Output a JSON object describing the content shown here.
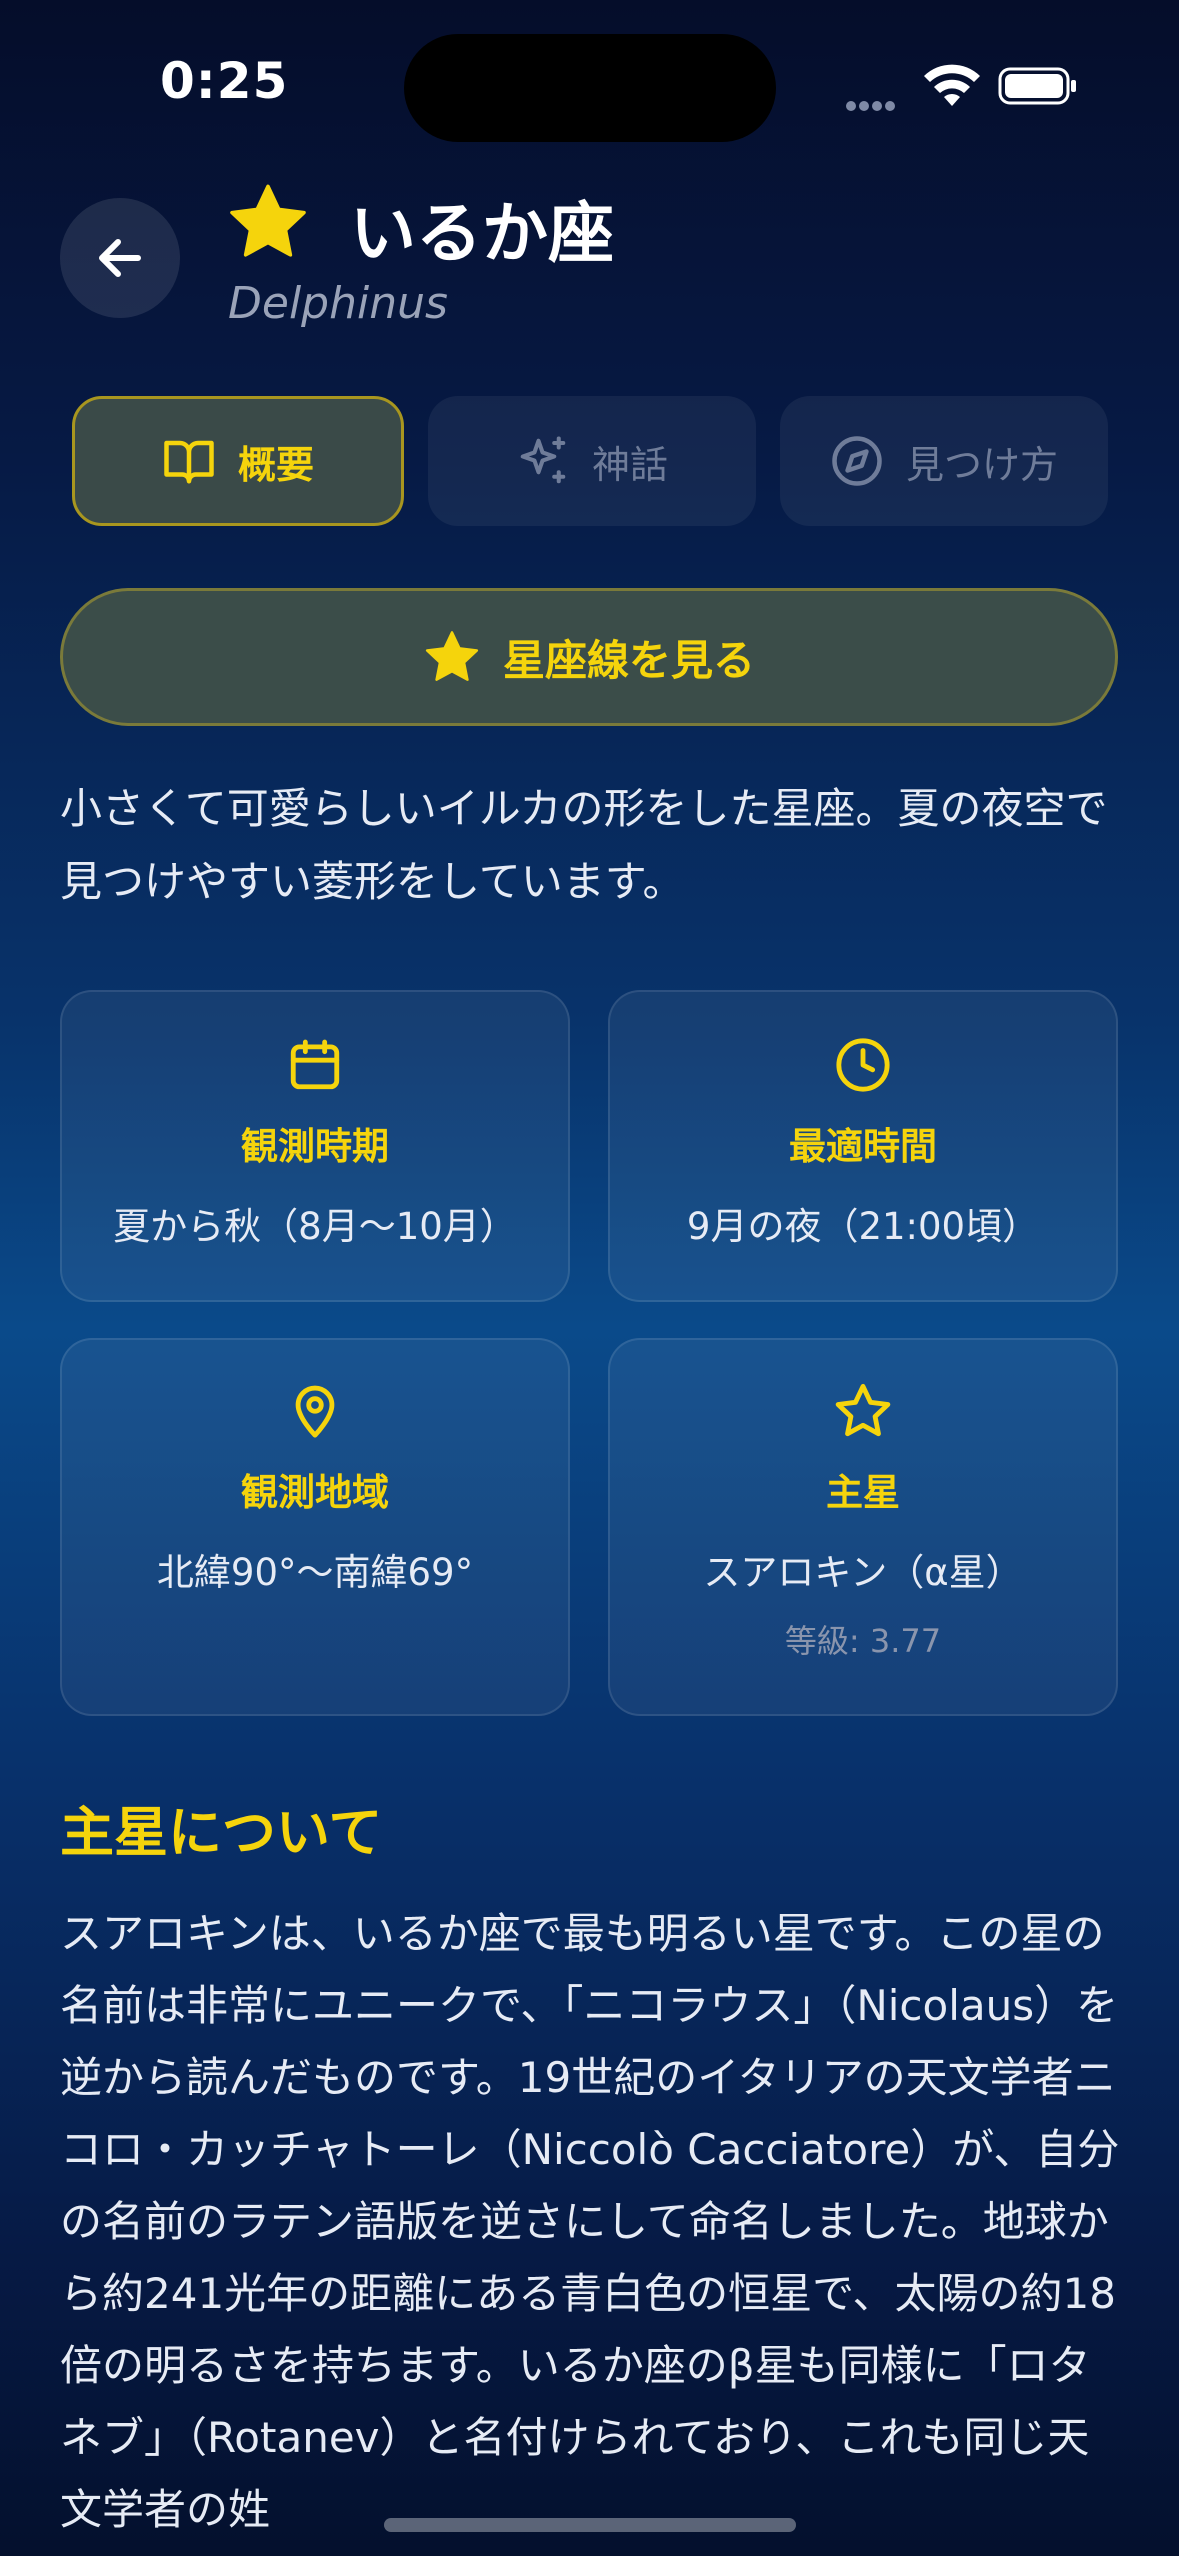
{
  "status_bar": {
    "time": "0:25"
  },
  "header": {
    "title": "いるか座",
    "subtitle": "Delphinus"
  },
  "tabs": [
    {
      "label": "概要",
      "icon": "book-icon",
      "active": true
    },
    {
      "label": "神話",
      "icon": "sparkles-icon",
      "active": false
    },
    {
      "label": "見つけ方",
      "icon": "compass-icon",
      "active": false
    }
  ],
  "constellation_button": {
    "label": "星座線を見る"
  },
  "description": "小さくて可愛らしいイルカの形をした星座。夏の夜空で見つけやすい菱形をしています。",
  "cards": {
    "season": {
      "label": "観測時期",
      "value": "夏から秋（8月〜10月）",
      "icon": "calendar-icon"
    },
    "best_time": {
      "label": "最適時間",
      "value": "9月の夜（21:00頃）",
      "icon": "clock-icon"
    },
    "region": {
      "label": "観測地域",
      "value": "北緯90°〜南緯69°",
      "icon": "map-pin-icon"
    },
    "main_star": {
      "label": "主星",
      "value": "スアロキン（α星）",
      "sub": "等級: 3.77",
      "icon": "star-outline-icon"
    }
  },
  "about": {
    "heading": "主星について",
    "body": "スアロキンは、いるか座で最も明るい星です。この星の名前は非常にユニークで、「ニコラウス」（Nicolaus）を逆から読んだものです。19世紀のイタリアの天文学者ニコロ・カッチャトーレ（Niccolò Cacciatore）が、自分の名前のラテン語版を逆さにして命名しました。地球から約241光年の距離にある青白色の恒星で、太陽の約18倍の明るさを持ちます。いるか座のβ星も同様に「ロタネブ」（Rotanev）と名付けられており、これも同じ天文学者の姓"
  },
  "colors": {
    "accent": "#f5d40c",
    "bg_top": "#050d2a",
    "bg_mid": "#0a4a8a",
    "text": "#e6ebf5",
    "muted": "#6f7c99"
  }
}
